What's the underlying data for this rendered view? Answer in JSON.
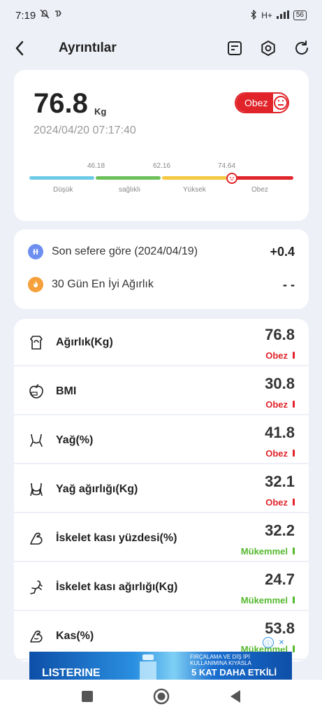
{
  "status_bar": {
    "time": "7:19",
    "network": "H+",
    "battery": "56"
  },
  "app_bar": {
    "title": "Ayrıntılar"
  },
  "summary": {
    "weight": "76.8",
    "unit": "Kg",
    "datetime": "2024/04/20 07:17:40",
    "badge": "Obez",
    "scale": {
      "ticks": [
        "46.18",
        "62.16",
        "74.64"
      ],
      "labels": [
        "Düşük",
        "sağlıklı",
        "Yüksek",
        "Obez"
      ],
      "colors": [
        "#6ecbe8",
        "#6cc05a",
        "#f5c842",
        "#e0242a"
      ]
    }
  },
  "comparison": {
    "rows": [
      {
        "icon": "compare-icon",
        "text": "Son sefere göre (2024/04/19)",
        "value": "+0.4",
        "color": "#6d8ff0"
      },
      {
        "icon": "fire-icon",
        "text": "30 Gün En İyi Ağırlık",
        "value": "- -",
        "color": "#f5a03a"
      }
    ]
  },
  "metrics": [
    {
      "icon": "scale-icon",
      "name": "Ağırlık(Kg)",
      "value": "76.8",
      "status": "Obez",
      "status_color": "#e0242a"
    },
    {
      "icon": "bmi-icon",
      "name": "BMI",
      "value": "30.8",
      "status": "Obez",
      "status_color": "#e0242a"
    },
    {
      "icon": "body-fat-icon",
      "name": "Yağ(%)",
      "value": "41.8",
      "status": "Obez",
      "status_color": "#e0242a"
    },
    {
      "icon": "fat-weight-icon",
      "name": "Yağ ağırlığı(Kg)",
      "value": "32.1",
      "status": "Obez",
      "status_color": "#e0242a"
    },
    {
      "icon": "muscle-arm-icon",
      "name": "İskelet kası yüzdesi(%)",
      "value": "32.2",
      "status": "Mükemmel",
      "status_color": "#55b82e"
    },
    {
      "icon": "running-icon",
      "name": "İskelet kası ağırlığı(Kg)",
      "value": "24.7",
      "status": "Mükemmel",
      "status_color": "#55b82e"
    },
    {
      "icon": "muscle-icon",
      "name": "Kas(%)",
      "value": "53.8",
      "status": "Mükemmel",
      "status_color": "#55b82e"
    }
  ],
  "ad": {
    "brand": "LISTERINE",
    "line1": "FIRÇALAMA VE DİŞ İPİ",
    "line2": "KULLANIMINA KIYASLA",
    "headline": "5 KAT DAHA ETKİLİ"
  }
}
